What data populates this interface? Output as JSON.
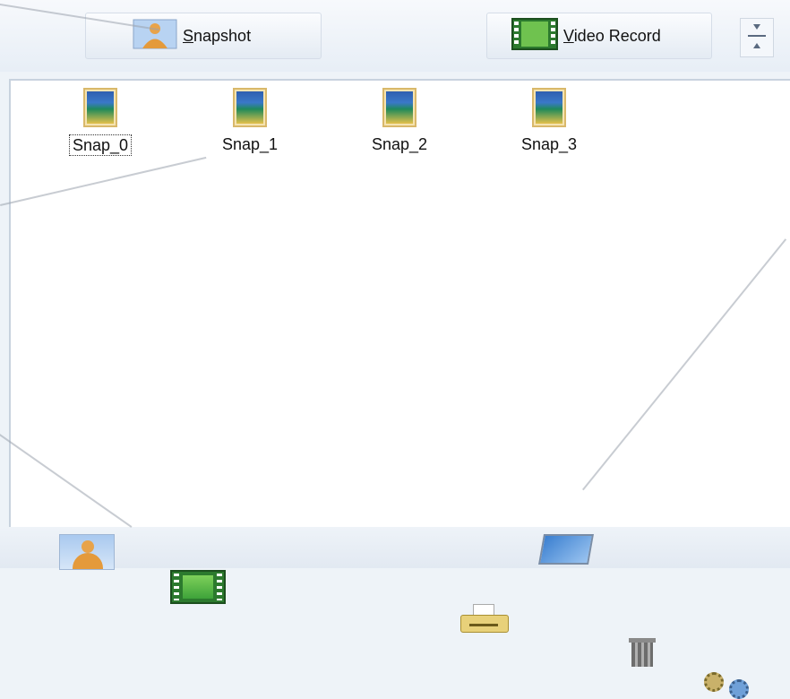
{
  "toolbar": {
    "snapshot_label": "Snapshot",
    "record_label": "Video Record"
  },
  "files": [
    {
      "name": "Snap_0",
      "selected": true
    },
    {
      "name": "Snap_1",
      "selected": false
    },
    {
      "name": "Snap_2",
      "selected": false
    },
    {
      "name": "Snap_3",
      "selected": false
    }
  ],
  "icons": {
    "snapshot": "person-photo-icon",
    "record": "film-strip-icon",
    "collapse": "splitter-icon",
    "file": "picture-icon",
    "bottom": [
      "person-photo-icon",
      "film-strip-icon",
      "printer-icon",
      "monitor-icon",
      "trash-icon",
      "tools-icon"
    ]
  },
  "colors": {
    "background": "#eef3f8",
    "pane": "#ffffff",
    "film_green": "#2c7a2e",
    "thumb_border": "#d9b86a"
  }
}
